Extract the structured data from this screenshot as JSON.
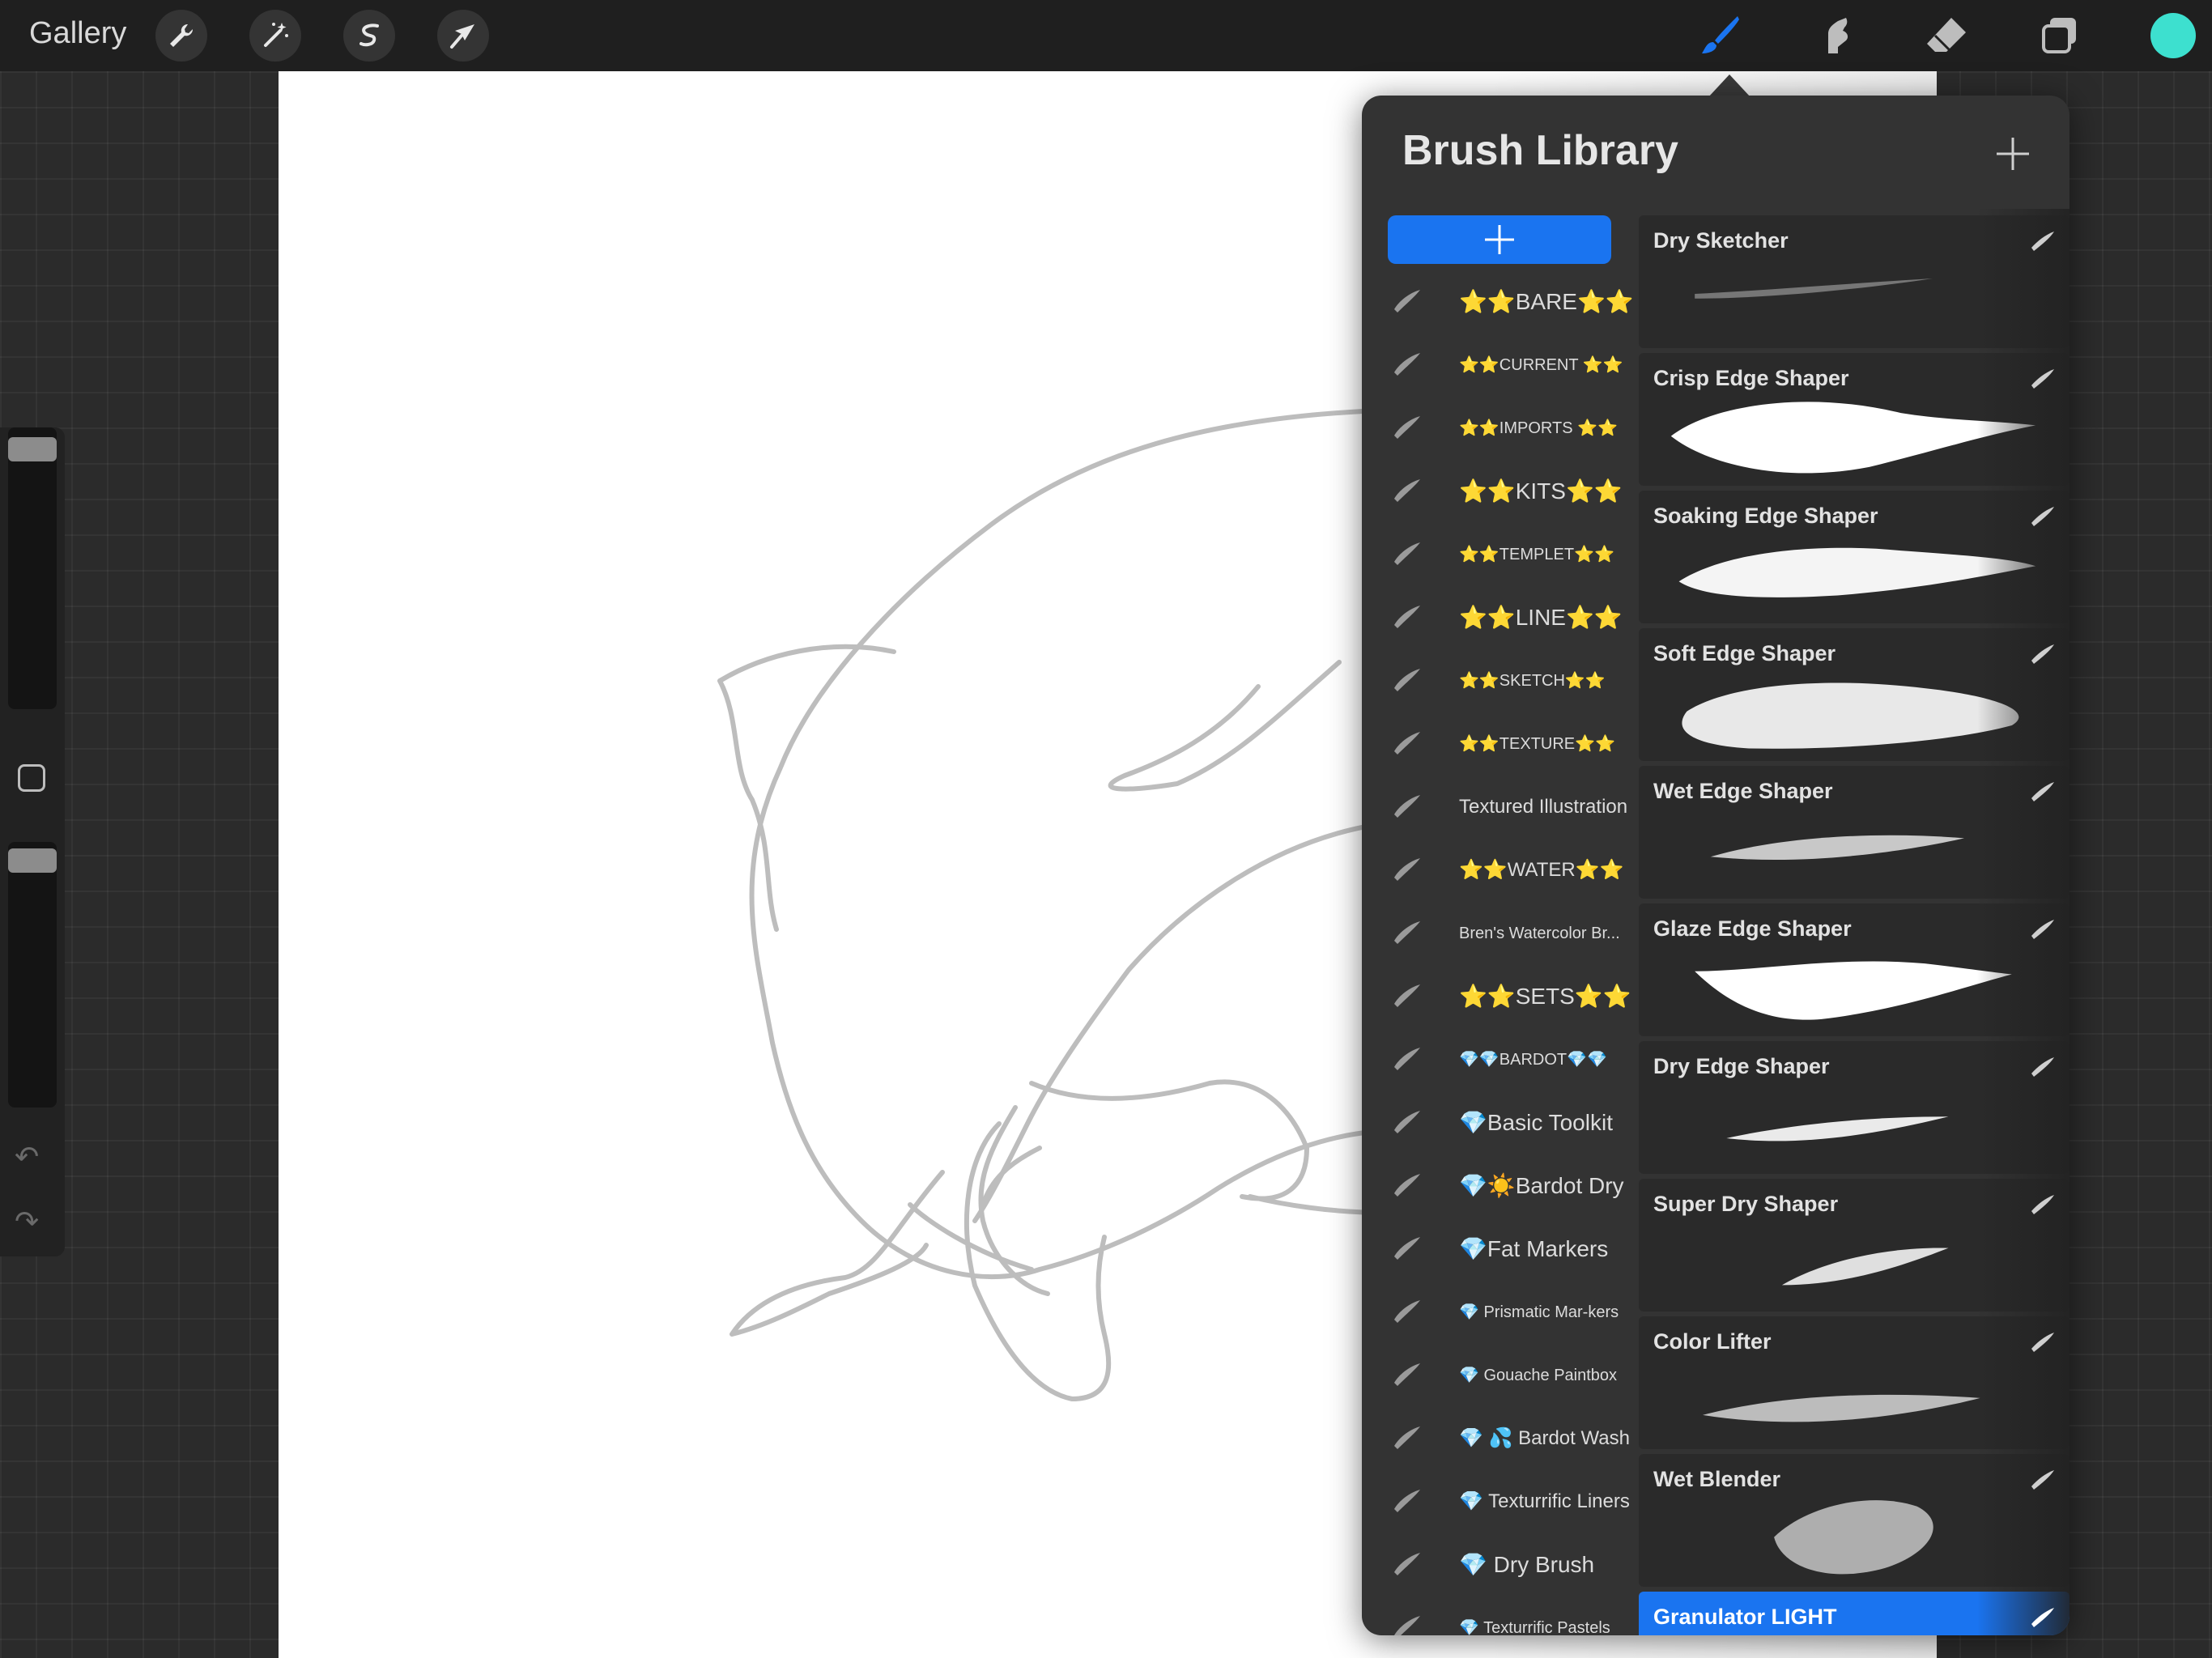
{
  "topbar": {
    "gallery_label": "Gallery",
    "left_tools": [
      "wrench-icon",
      "magic-wand-icon",
      "selection-icon",
      "transform-arrow-icon"
    ],
    "right_tools": [
      "brush-icon",
      "smudge-icon",
      "eraser-icon",
      "layers-icon"
    ],
    "active_tool": "brush-icon",
    "accent_color": "#1a74f0",
    "current_color": "#3de0cf"
  },
  "brush_library": {
    "title": "Brush Library",
    "sets": [
      {
        "label": "⭐⭐BARE⭐⭐"
      },
      {
        "label": "⭐⭐CURRENT ⭐⭐"
      },
      {
        "label": "⭐⭐IMPORTS ⭐⭐"
      },
      {
        "label": "⭐⭐KITS⭐⭐"
      },
      {
        "label": "⭐⭐TEMPLET⭐⭐"
      },
      {
        "label": "⭐⭐LINE⭐⭐"
      },
      {
        "label": "⭐⭐SKETCH⭐⭐"
      },
      {
        "label": "⭐⭐TEXTURE⭐⭐"
      },
      {
        "label": "Textured Illustration"
      },
      {
        "label": "⭐⭐WATER⭐⭐"
      },
      {
        "label": "Bren's Watercolor Br..."
      },
      {
        "label": "⭐⭐SETS⭐⭐"
      },
      {
        "label": "💎💎BARDOT💎💎"
      },
      {
        "label": "💎Basic Toolkit"
      },
      {
        "label": "💎☀️Bardot Dry"
      },
      {
        "label": "💎Fat Markers"
      },
      {
        "label": "💎 Prismatic Mar-kers"
      },
      {
        "label": "💎 Gouache Paintbox"
      },
      {
        "label": "💎 💦 Bardot Wash"
      },
      {
        "label": "💎 Texturrific Liners"
      },
      {
        "label": "💎 Dry Brush"
      },
      {
        "label": "💎 Texturrific Pastels"
      }
    ],
    "brushes": [
      {
        "name": "Dry Sketcher"
      },
      {
        "name": "Crisp Edge Shaper"
      },
      {
        "name": "Soaking Edge Shaper"
      },
      {
        "name": "Soft Edge Shaper"
      },
      {
        "name": "Wet Edge Shaper"
      },
      {
        "name": "Glaze Edge Shaper"
      },
      {
        "name": "Dry Edge Shaper"
      },
      {
        "name": "Super Dry Shaper"
      },
      {
        "name": "Color Lifter"
      },
      {
        "name": "Wet Blender"
      },
      {
        "name": "Granulator LIGHT"
      }
    ],
    "selected_brush": "Granulator LIGHT"
  }
}
